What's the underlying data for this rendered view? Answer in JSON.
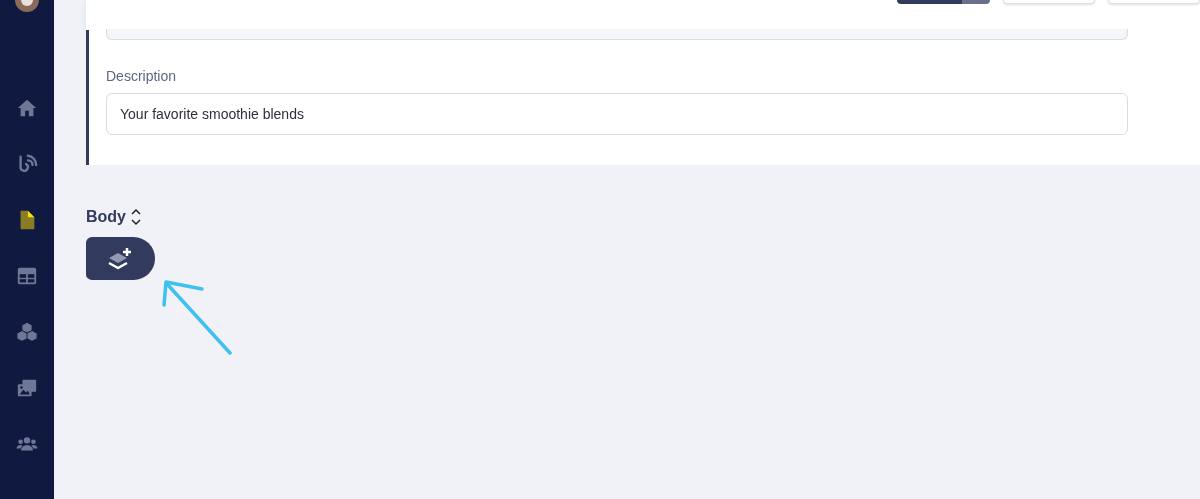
{
  "sidebar": {
    "items": [
      {
        "kind": "home",
        "selected": false
      },
      {
        "kind": "webhook",
        "selected": false
      },
      {
        "kind": "document",
        "selected": true
      },
      {
        "kind": "table",
        "selected": false
      },
      {
        "kind": "blocks",
        "selected": false
      },
      {
        "kind": "media",
        "selected": false
      },
      {
        "kind": "users",
        "selected": false
      }
    ]
  },
  "header": {
    "buttons": [
      {
        "kind": "primary"
      },
      {
        "kind": "secondary"
      },
      {
        "kind": "secondary"
      }
    ]
  },
  "form": {
    "fields": [
      {
        "label": "Description",
        "value": "Your favorite smoothie blends"
      }
    ]
  },
  "body": {
    "label": "Body"
  }
}
